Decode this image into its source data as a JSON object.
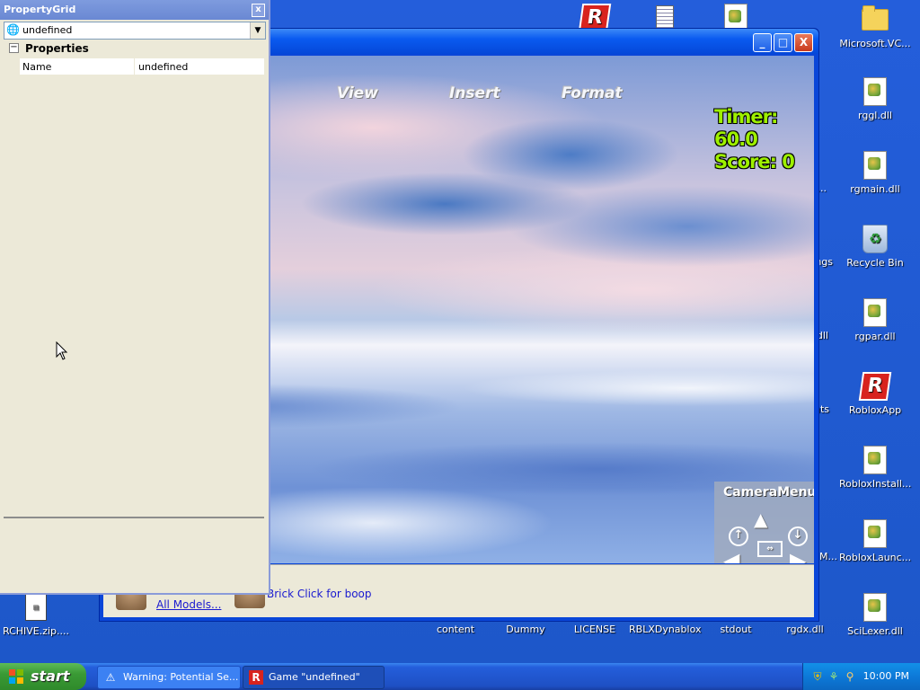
{
  "desktop": {
    "icons": [
      {
        "label": "",
        "icon": "roblox-icon"
      },
      {
        "label": "",
        "icon": "notepad-icon"
      },
      {
        "label": "",
        "icon": "dll-icon"
      },
      {
        "label": "Microsoft.VC...",
        "icon": "folder-icon"
      },
      {
        "label": "rggl.dll",
        "icon": "dll-icon"
      },
      {
        "label": "rgmain.dll",
        "icon": "dll-icon"
      },
      {
        "label": "Recycle Bin",
        "icon": "recycle-bin-icon"
      },
      {
        "label": "rgpar.dll",
        "icon": "dll-icon"
      },
      {
        "label": "RobloxApp",
        "icon": "roblox-icon"
      },
      {
        "label": "RobloxInstall...",
        "icon": "dll-icon"
      },
      {
        "label": "RobloxLaunc...",
        "icon": "dll-icon"
      },
      {
        "label": "SciLexer.dll",
        "icon": "dll-icon"
      },
      {
        "label": "RCHIVE.zip....",
        "icon": "zip-icon"
      },
      {
        "label": "content",
        "icon": "folder-icon"
      },
      {
        "label": "Dummy",
        "icon": "file-icon"
      },
      {
        "label": "LICENSE",
        "icon": "file-icon"
      },
      {
        "label": "RBLXDynablox",
        "icon": "file-icon"
      },
      {
        "label": "stdout",
        "icon": "file-icon"
      },
      {
        "label": "rgdx.dll",
        "icon": "dll-icon"
      }
    ],
    "partial_labels": [
      "VC...",
      "ngs",
      "dll",
      "nts",
      "M..."
    ]
  },
  "property_grid": {
    "title": "PropertyGrid",
    "close_label": "x",
    "selected_object": "undefined",
    "category": "Properties",
    "category_toggle": "−",
    "rows": [
      {
        "name": "Name",
        "value": "undefined"
      }
    ]
  },
  "game_window": {
    "menu": [
      "View",
      "Insert",
      "Format"
    ],
    "timer_text": "Timer: 60.0",
    "score_text": "Score: 0",
    "camera_menu_label": "CameraMenu",
    "toolbox": {
      "all_models_link": "All Models...",
      "brick_text": "Brick Click for boop"
    },
    "window_buttons": {
      "minimize": "_",
      "maximize": "□",
      "close": "X"
    }
  },
  "taskbar": {
    "start_label": "start",
    "tasks": [
      {
        "label": "Warning: Potential Se...",
        "icon": "warning-icon"
      },
      {
        "label": "Game \"undefined\"",
        "icon": "roblox-icon"
      }
    ],
    "clock": "10:00 PM"
  },
  "colors": {
    "desktop": "#245edb",
    "taskbar": "#245edb",
    "start_green": "#3a9a35",
    "hud_green": "#9ef000",
    "link_blue": "#1a1ad0"
  }
}
